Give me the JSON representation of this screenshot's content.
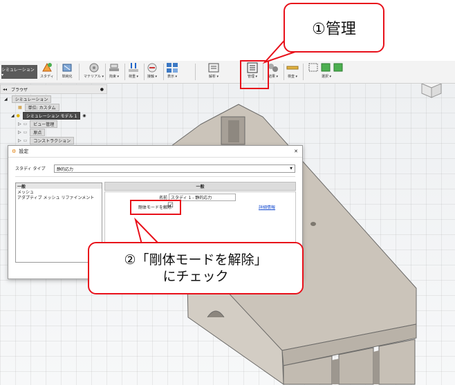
{
  "toolbar": {
    "workspace": "シミュレーション ▾",
    "items": [
      {
        "label": "スタディ",
        "icon": "study-icon"
      },
      {
        "label": "単純化",
        "icon": "simplify-icon"
      },
      {
        "label": "マテリアル ▾",
        "icon": "material-icon"
      },
      {
        "label": "拘束 ▾",
        "icon": "constraint-icon"
      },
      {
        "label": "荷重 ▾",
        "icon": "load-icon"
      },
      {
        "label": "接触 ▾",
        "icon": "contact-icon"
      },
      {
        "label": "表示 ▾",
        "icon": "display-icon"
      },
      {
        "label": "解析 ▾",
        "icon": "solve-icon"
      },
      {
        "label": "管理 ▾",
        "icon": "manage-icon"
      },
      {
        "label": "結果 ▾",
        "icon": "results-icon"
      },
      {
        "label": "検査 ▾",
        "icon": "inspect-icon"
      },
      {
        "label": "選択 ▾",
        "icon": "select-icon"
      }
    ]
  },
  "browser": {
    "title": "ブラウザ",
    "rows": [
      {
        "label": "シミュレーション"
      },
      {
        "label": "単位: カスタム"
      },
      {
        "label": "シミュレーション モデル 1"
      },
      {
        "label": "ビュー管理"
      },
      {
        "label": "原点"
      },
      {
        "label": "コンストラクション"
      }
    ]
  },
  "dialog": {
    "title": "設定",
    "study_type_label": "スタディ タイプ",
    "study_type_value": "静的応力",
    "left_items": [
      "一般",
      "メッシュ",
      "アダプティブ メッシュ リファインメント"
    ],
    "right_header": "一般",
    "name_label": "名前",
    "name_value": "スタディ 1 - 静的応力",
    "rigid_label": "剛体モードを解除",
    "rigid_checked": "☑",
    "details_link": "詳細情報"
  },
  "callouts": {
    "one": "①管理",
    "two_line1": "②「剛体モードを解除」",
    "two_line2": "にチェック"
  }
}
